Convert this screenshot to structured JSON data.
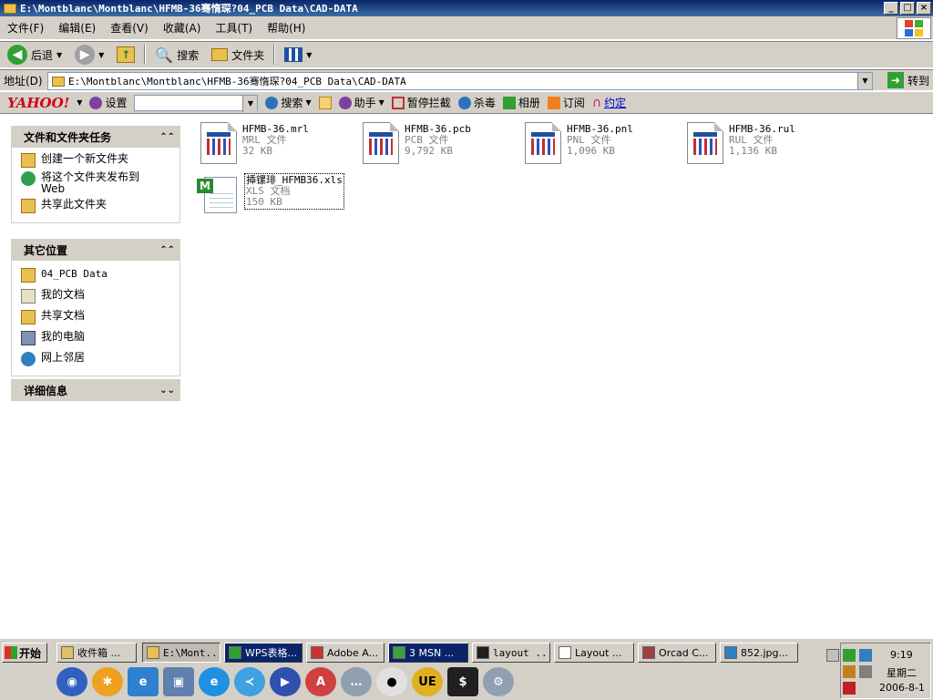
{
  "window": {
    "title": "E:\\Montblanc\\Montblanc\\HFMB-36骞惰琛?04_PCB Data\\CAD-DATA",
    "min_glyph": "_",
    "max_glyph": "□",
    "close_glyph": "×"
  },
  "menu": [
    "文件(F)",
    "编辑(E)",
    "查看(V)",
    "收藏(A)",
    "工具(T)",
    "帮助(H)"
  ],
  "toolbar": {
    "back_label": "后退",
    "search_label": "搜索",
    "folders_label": "文件夹"
  },
  "address": {
    "label": "地址(D)",
    "value": "E:\\Montblanc\\Montblanc\\HFMB-36骞惰琛?04_PCB Data\\CAD-DATA",
    "go_label": "转到"
  },
  "yahoo": {
    "logo": "YAHOO!",
    "settings": "设置",
    "search": "搜索",
    "assistant": "助手",
    "block": "暂停拦截",
    "antivirus": "杀毒",
    "album": "相册",
    "subscribe": "订阅",
    "date": "约定"
  },
  "panels": {
    "tasks": {
      "title": "文件和文件夹任务",
      "items": [
        "创建一个新文件夹",
        "将这个文件夹发布到 Web",
        "共享此文件夹"
      ]
    },
    "places": {
      "title": "其它位置",
      "items": [
        "04_PCB Data",
        "我的文档",
        "共享文档",
        "我的电脑",
        "网上邻居"
      ]
    },
    "details": {
      "title": "详细信息"
    }
  },
  "files": [
    {
      "name": "HFMB-36.mrl",
      "type": "MRL 文件",
      "size": "32 KB"
    },
    {
      "name": "HFMB-36.pcb",
      "type": "PCB 文件",
      "size": "9,792 KB"
    },
    {
      "name": "HFMB-36.pnl",
      "type": "PNL 文件",
      "size": "1,096 KB"
    },
    {
      "name": "HFMB-36.rul",
      "type": "RUL 文件",
      "size": "1,136 KB"
    },
    {
      "name": "揷镙琲_HFMB36.xls",
      "type": "XLS 文档",
      "size": "150 KB"
    }
  ],
  "taskbar": {
    "start": "开始",
    "buttons": [
      "收件箱 ...",
      "E:\\Mont...",
      "WPS表格...",
      "Adobe A...",
      "3 MSN ...",
      "layout ...",
      "Layout ...",
      "Orcad C...",
      "852.jpg..."
    ],
    "clock_time": "9:19",
    "clock_day": "星期二",
    "clock_date": "2006-8-1"
  }
}
